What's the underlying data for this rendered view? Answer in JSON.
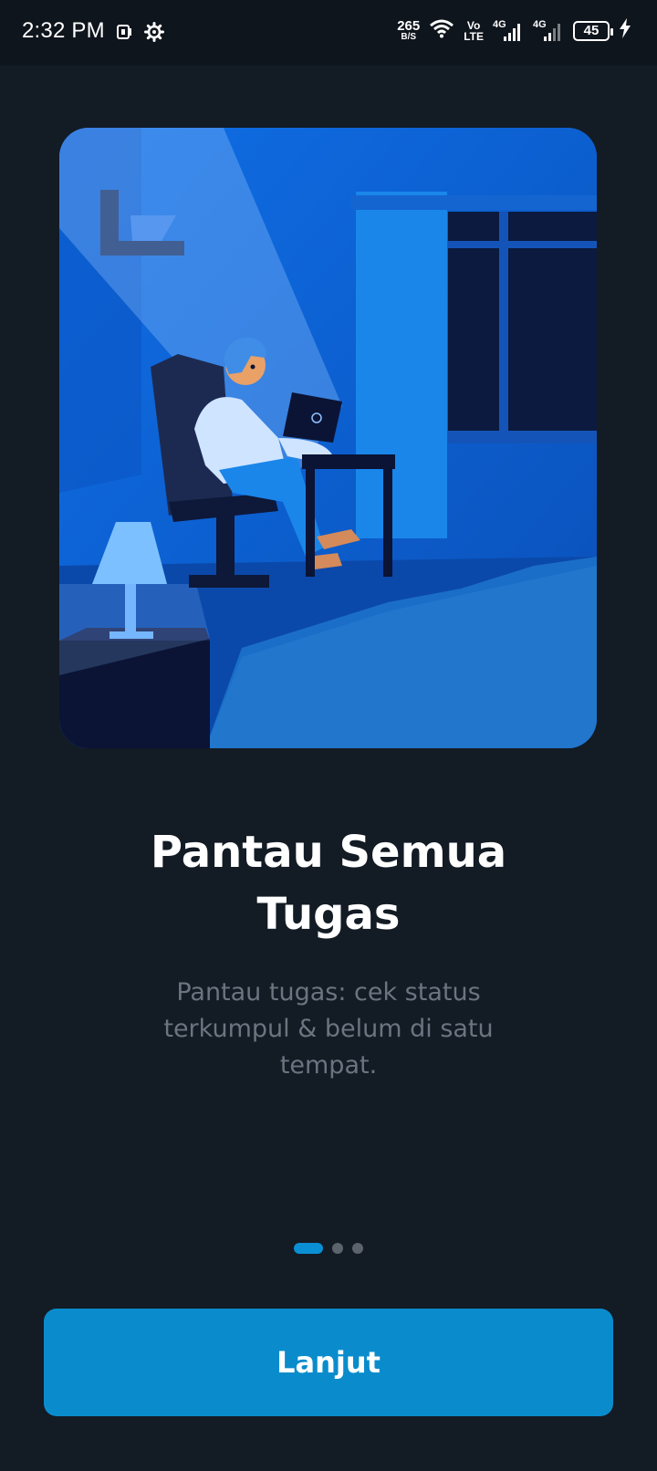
{
  "status_bar": {
    "time": "2:32 PM",
    "net_speed_value": "265",
    "net_speed_unit": "B/S",
    "volte_top": "Vo",
    "volte_bottom": "LTE",
    "sim1_type": "4G",
    "sim2_type": "4G",
    "battery": "45"
  },
  "onboarding": {
    "title": "Pantau Semua Tugas",
    "description": "Pantau tugas: cek status terkumpul & belum di satu tempat.",
    "page_indicator": {
      "current": 1,
      "total": 3
    },
    "next_button": "Lanjut"
  },
  "colors": {
    "background": "#131b25",
    "accent": "#0a8ccc",
    "subtitle": "#6b7480"
  }
}
